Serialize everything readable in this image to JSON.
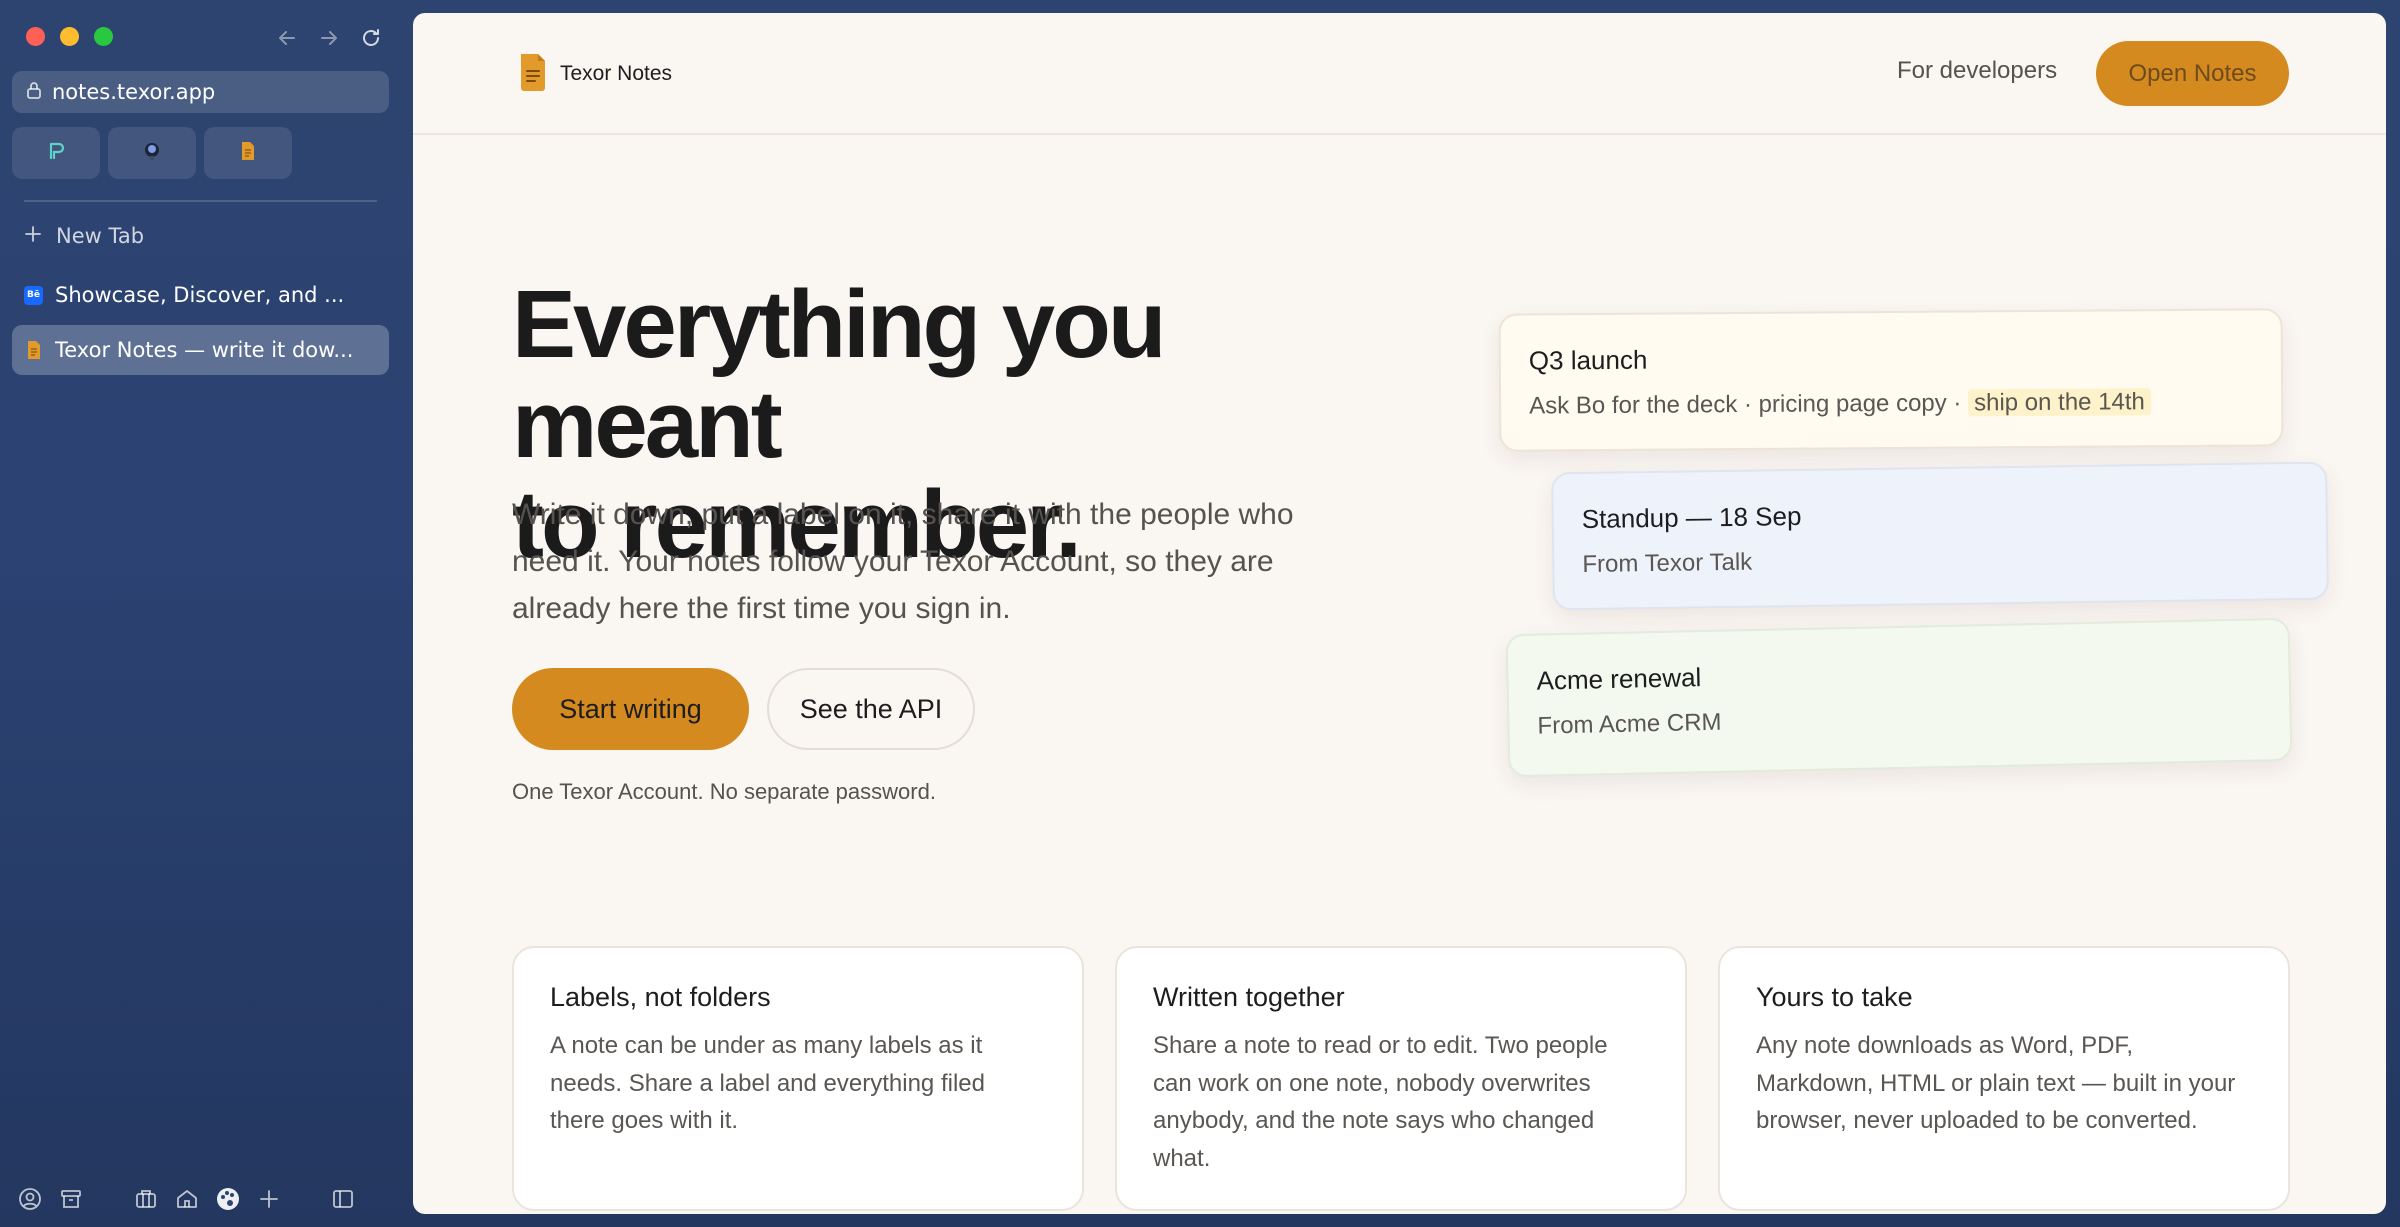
{
  "browser": {
    "url": "notes.texor.app",
    "new_tab_label": "New Tab",
    "tabs": [
      {
        "label": "Showcase, Discover, and ...",
        "favicon": "Bē"
      },
      {
        "label": "Texor Notes — write it dow...",
        "favicon": "notes-icon"
      }
    ],
    "pinned": [
      "threads-icon",
      "microphone-icon",
      "notes-icon"
    ]
  },
  "site": {
    "brand": "Texor Notes",
    "nav_link": "For developers",
    "nav_cta": "Open Notes",
    "hero_title_line1": "Everything you meant",
    "hero_title_line2": "to remember.",
    "hero_sub": "Write it down, put a label on it, share it with the people who need it. Your notes follow your Texor Account, so they are already here the first time you sign in.",
    "cta_primary": "Start writing",
    "cta_secondary": "See the API",
    "footnote": "One Texor Account. No separate password.",
    "notes": [
      {
        "title": "Q3 launch",
        "body": "Ask Bo for the deck · pricing page copy · ",
        "highlight": "ship on the 14th"
      },
      {
        "title": "Standup — 18 Sep",
        "body": "From Texor Talk"
      },
      {
        "title": "Acme renewal",
        "body": "From Acme CRM"
      }
    ],
    "features": [
      {
        "title": "Labels, not folders",
        "body": "A note can be under as many labels as it needs. Share a label and everything filed there goes with it."
      },
      {
        "title": "Written together",
        "body": "Share a note to read or to edit. Two people can work on one note, nobody overwrites anybody, and the note says who changed what."
      },
      {
        "title": "Yours to take",
        "body": "Any note downloads as Word, PDF, Markdown, HTML or plain text — built in your browser, never uploaded to be converted."
      }
    ]
  },
  "colors": {
    "accent": "#d58a1f",
    "page_bg": "#faf6f2",
    "sidebar_bg": "#2e4470"
  }
}
